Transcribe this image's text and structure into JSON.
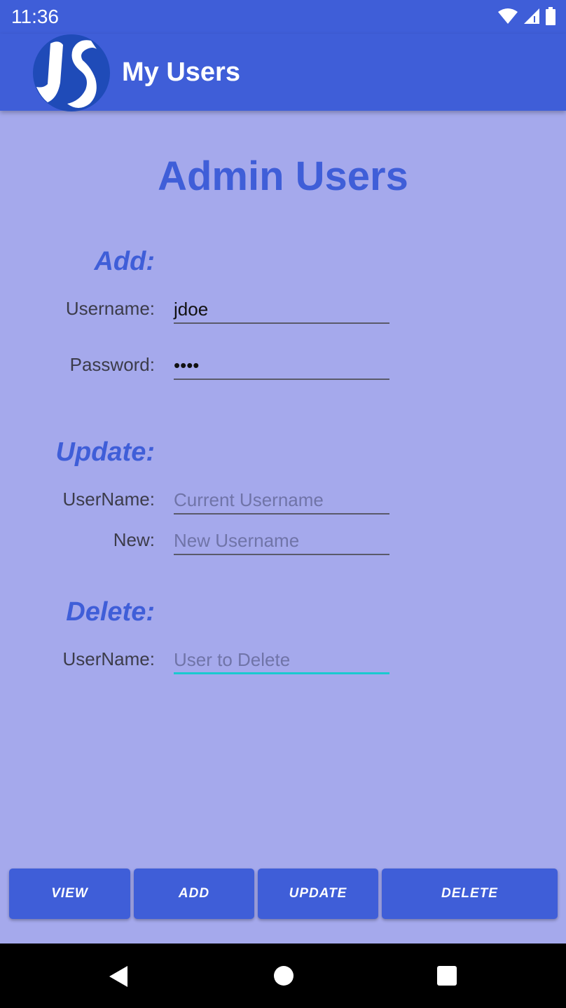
{
  "status": {
    "time": "11:36"
  },
  "app_bar": {
    "title": "My Users",
    "logo_icon": "js-logo-icon"
  },
  "page": {
    "title": "Admin Users"
  },
  "add": {
    "heading": "Add:",
    "username_label": "Username:",
    "username_value": "jdoe",
    "password_label": "Password:",
    "password_value": "••••"
  },
  "update": {
    "heading": "Update:",
    "username_label": "UserName:",
    "username_placeholder": "Current Username",
    "new_label": "New:",
    "new_placeholder": "New Username"
  },
  "delete": {
    "heading": "Delete:",
    "username_label": "UserName:",
    "username_placeholder": "User to Delete"
  },
  "buttons": {
    "view": "VIEW",
    "add": "ADD",
    "update": "UPDATE",
    "delete": "DELETE"
  },
  "colors": {
    "primary": "#3f5ed8",
    "background": "#a5a9ec",
    "focus_underline": "#19c9cf"
  }
}
